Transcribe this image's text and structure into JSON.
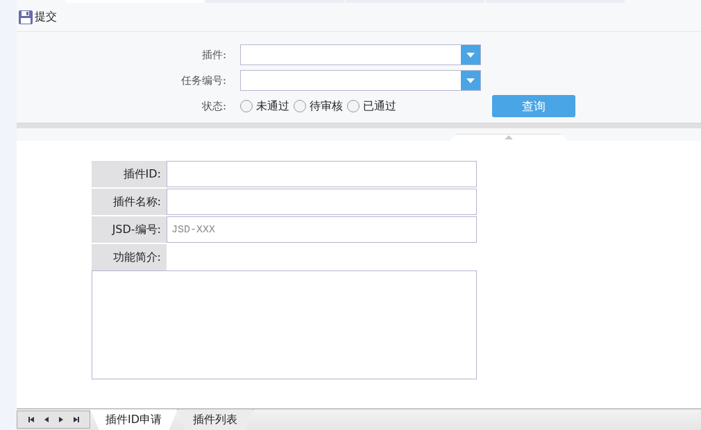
{
  "toolbar": {
    "submit_label": "提交"
  },
  "filters": {
    "plugin": {
      "label": "插件:"
    },
    "task_number": {
      "label": "任务编号:"
    },
    "status": {
      "label": "状态:",
      "options": [
        {
          "label": "未通过",
          "selected": false
        },
        {
          "label": "待审核",
          "selected": false
        },
        {
          "label": "已通过",
          "selected": false
        }
      ]
    },
    "query_button": "查询"
  },
  "form": {
    "fields": [
      {
        "kind": "input",
        "label": "插件ID:"
      },
      {
        "kind": "input",
        "label": "插件名称:"
      },
      {
        "kind": "input",
        "label": "JSD-编号:",
        "placeholder": "JSD-XXX"
      },
      {
        "kind": "textarea",
        "label": "功能简介:"
      }
    ]
  },
  "sheet_tabs": [
    {
      "label": "插件ID申请",
      "selected": true
    },
    {
      "label": "插件列表",
      "selected": false
    }
  ]
}
